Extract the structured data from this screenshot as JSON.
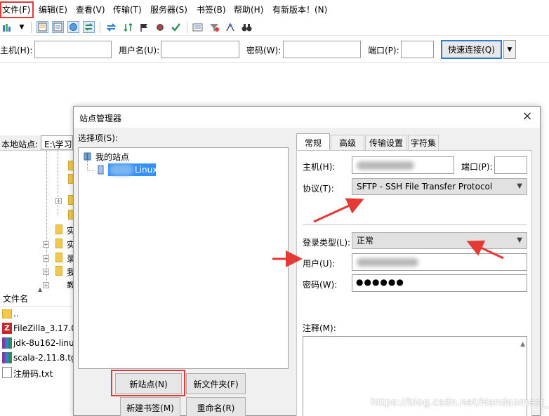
{
  "menubar": {
    "items": [
      "文件(F)",
      "编辑(E)",
      "查看(V)",
      "传输(T)",
      "服务器(S)",
      "书签(B)",
      "帮助(H)",
      "有新版本！(N)"
    ]
  },
  "toolbar": {
    "icons": [
      "site-manager-icon",
      "dropdown-arrow-icon",
      "message-log-icon",
      "local-tree-icon",
      "remote-tree-icon",
      "transfer-queue-icon",
      "refresh-icon",
      "process-queue-icon",
      "cancel-icon",
      "disconnect-icon",
      "reconnect-icon",
      "directory-listing-icon",
      "filter-icon",
      "compare-icon",
      "search-icon"
    ]
  },
  "quickconnect": {
    "host_label": "主机(H):",
    "user_label": "用户名(U):",
    "pass_label": "密码(W):",
    "port_label": "端口(P):",
    "connect_label": "快速连接(Q)"
  },
  "local": {
    "site_label": "本地站点:",
    "path": "E:\\学习",
    "tree_labels": [
      "实",
      "实",
      "录",
      "我",
      "教"
    ],
    "file_header": "文件名",
    "files": [
      "..",
      "FileZilla_3.17.0.",
      "jdk-8u162-linu",
      "scala-2.11.8.tg:",
      "注册码.txt"
    ]
  },
  "dialog": {
    "title": "站点管理器",
    "close": "×",
    "select_label": "选择项(S):",
    "tree": {
      "root": "我的站点",
      "child": "Linux"
    },
    "buttons": {
      "new_site": "新站点(N)",
      "new_folder": "新文件夹(F)",
      "new_bookmark": "新建书签(M)",
      "rename": "重命名(R)"
    },
    "tabs": [
      "常规",
      "高级",
      "传输设置",
      "字符集"
    ],
    "form": {
      "host_label": "主机(H):",
      "port_label": "端口(P):",
      "protocol_label": "协议(T):",
      "protocol_value": "SFTP - SSH File Transfer Protocol",
      "logon_label": "登录类型(L):",
      "logon_value": "正常",
      "user_label": "用户(U):",
      "pass_label": "密码(W):",
      "pass_value": "●●●●●●",
      "comments_label": "注释(M):"
    }
  },
  "annotations": {
    "arrow_color": "#e53935",
    "highlight_color": "#e53935"
  },
  "watermark": "https://blog.csdn.net/Handsomest_"
}
